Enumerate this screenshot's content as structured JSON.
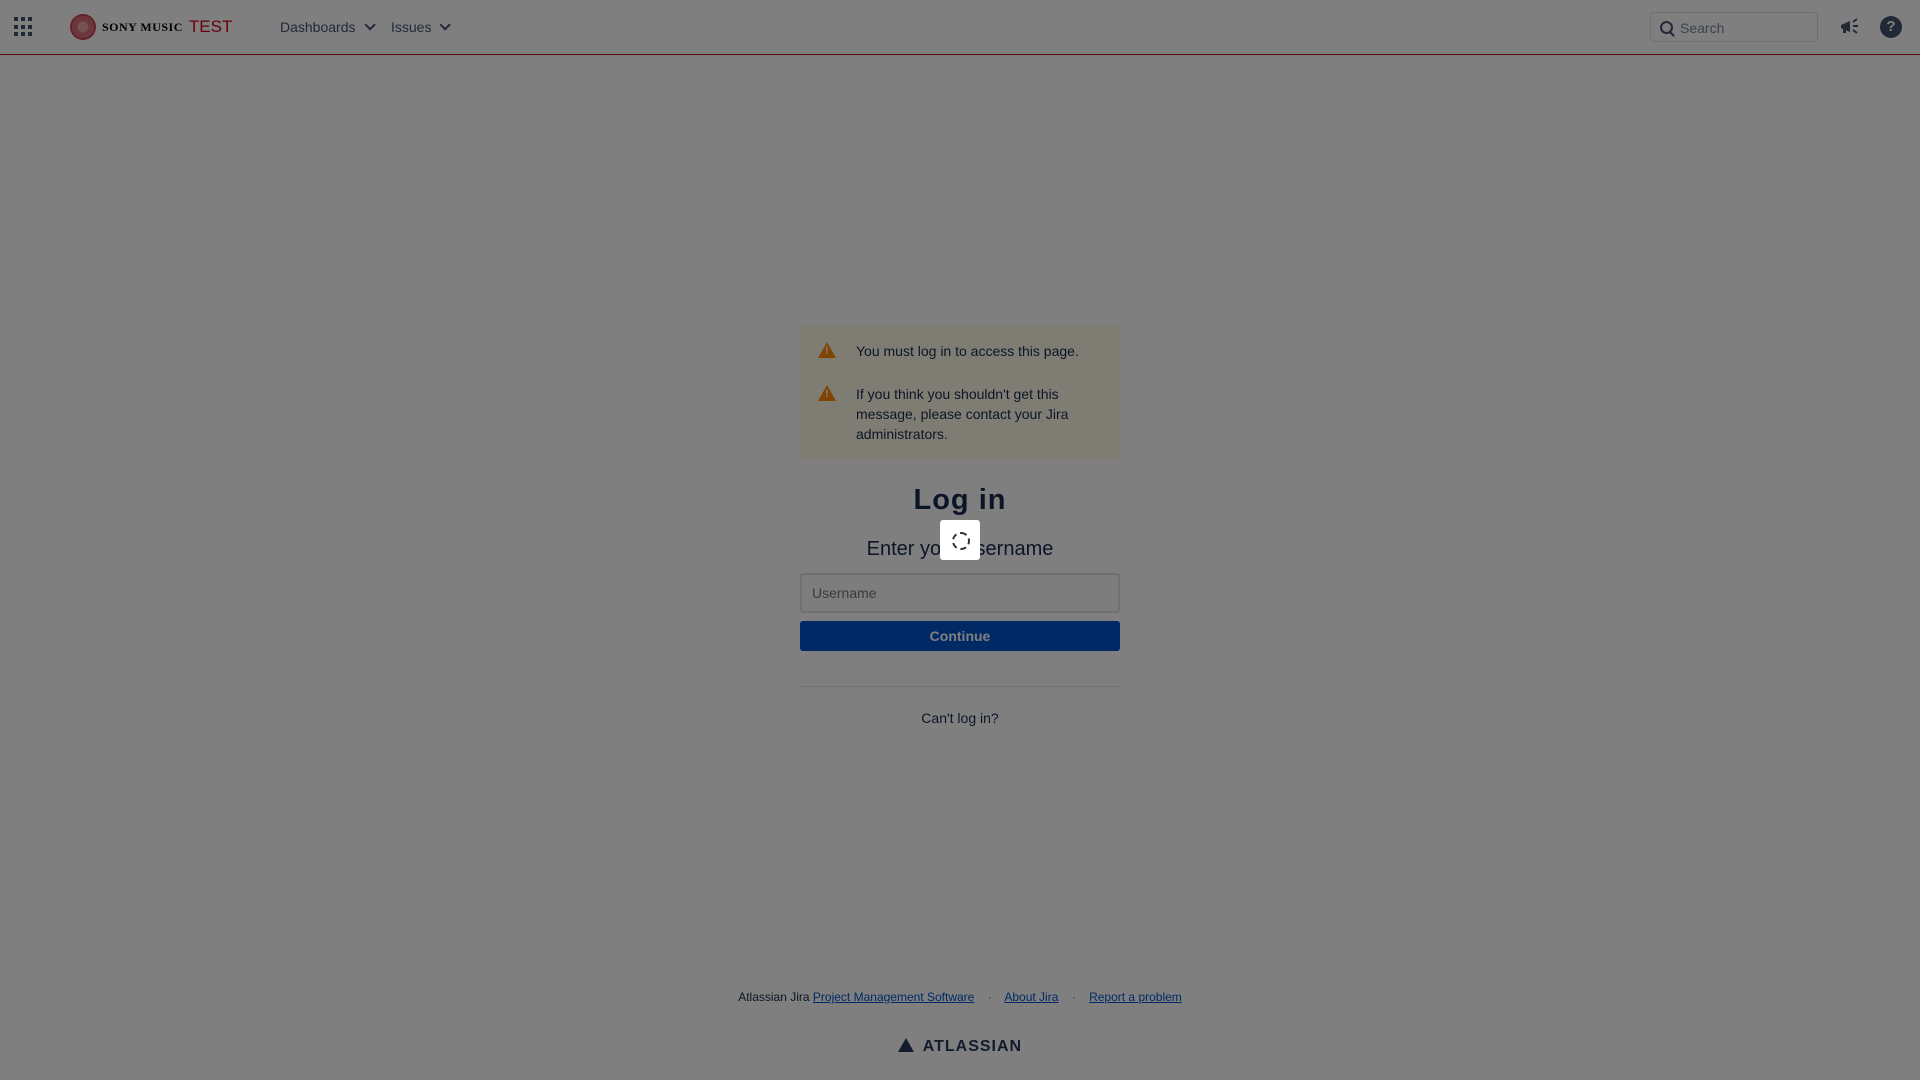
{
  "header": {
    "logo_text": "SONY MUSIC",
    "logo_suffix": "TEST",
    "nav": [
      {
        "label": "Dashboards"
      },
      {
        "label": "Issues"
      }
    ],
    "search_placeholder": "Search",
    "help_label": "?"
  },
  "warnings": [
    {
      "text": "You must log in to access this page."
    },
    {
      "text": "If you think you shouldn't get this message, please contact your Jira administrators."
    }
  ],
  "login": {
    "title": "Log in",
    "subtitle": "Enter your username",
    "username_placeholder": "Username",
    "username_value": "",
    "continue_label": "Continue",
    "cant_login_label": "Can't log in?"
  },
  "footer": {
    "prefix": "Atlassian Jira",
    "links": [
      {
        "label": "Project Management Software"
      },
      {
        "label": "About Jira"
      },
      {
        "label": "Report a problem"
      }
    ],
    "separator": "·",
    "brand": "ATLASSIAN"
  },
  "colors": {
    "header_border": "#b31b2f",
    "warning_bg": "#fffae6",
    "warning_icon": "#ff8b00",
    "primary_button": "#0052cc",
    "overlay": "rgba(0,0,0,0.5)"
  },
  "icons": {
    "app_switcher": "grid-icon",
    "search": "search-icon",
    "announce": "megaphone-icon",
    "help": "help-icon",
    "warning": "warning-icon",
    "loading": "spinner-icon"
  }
}
